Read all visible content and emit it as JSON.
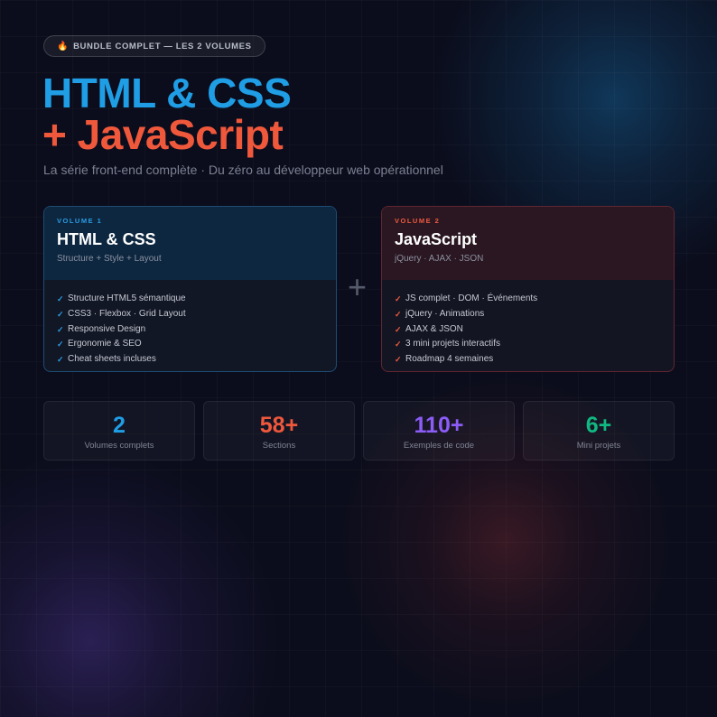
{
  "badge": {
    "icon": "fire-icon",
    "text": "BUNDLE COMPLET — LES 2 VOLUMES"
  },
  "title": {
    "line1": "HTML & CSS",
    "line2": "+ JavaScript"
  },
  "subtitle": "La série front-end complète · Du zéro au développeur web opérationnel",
  "colors": {
    "blue": "#1f9ee6",
    "red": "#f0583c",
    "purple": "#8b5cf6",
    "green": "#10b981"
  },
  "volumes": [
    {
      "label": "VOLUME 1",
      "name": "HTML & CSS",
      "tagline": "Structure + Style + Layout",
      "features": [
        "Structure HTML5 sémantique",
        "CSS3 · Flexbox · Grid Layout",
        "Responsive Design",
        "Ergonomie & SEO",
        "Cheat sheets incluses"
      ]
    },
    {
      "label": "VOLUME 2",
      "name": "JavaScript",
      "tagline": "jQuery · AJAX · JSON",
      "features": [
        "JS complet · DOM · Événements",
        "jQuery · Animations",
        "AJAX & JSON",
        "3 mini projets interactifs",
        "Roadmap 4 semaines"
      ]
    }
  ],
  "plus_sign": "+",
  "check_glyph": "✓",
  "stats": [
    {
      "value": "2",
      "label": "Volumes complets",
      "color": "#1f9ee6"
    },
    {
      "value": "58+",
      "label": "Sections",
      "color": "#f0583c"
    },
    {
      "value": "110+",
      "label": "Exemples de code",
      "color": "#8b5cf6"
    },
    {
      "value": "6+",
      "label": "Mini projets",
      "color": "#10b981"
    }
  ]
}
